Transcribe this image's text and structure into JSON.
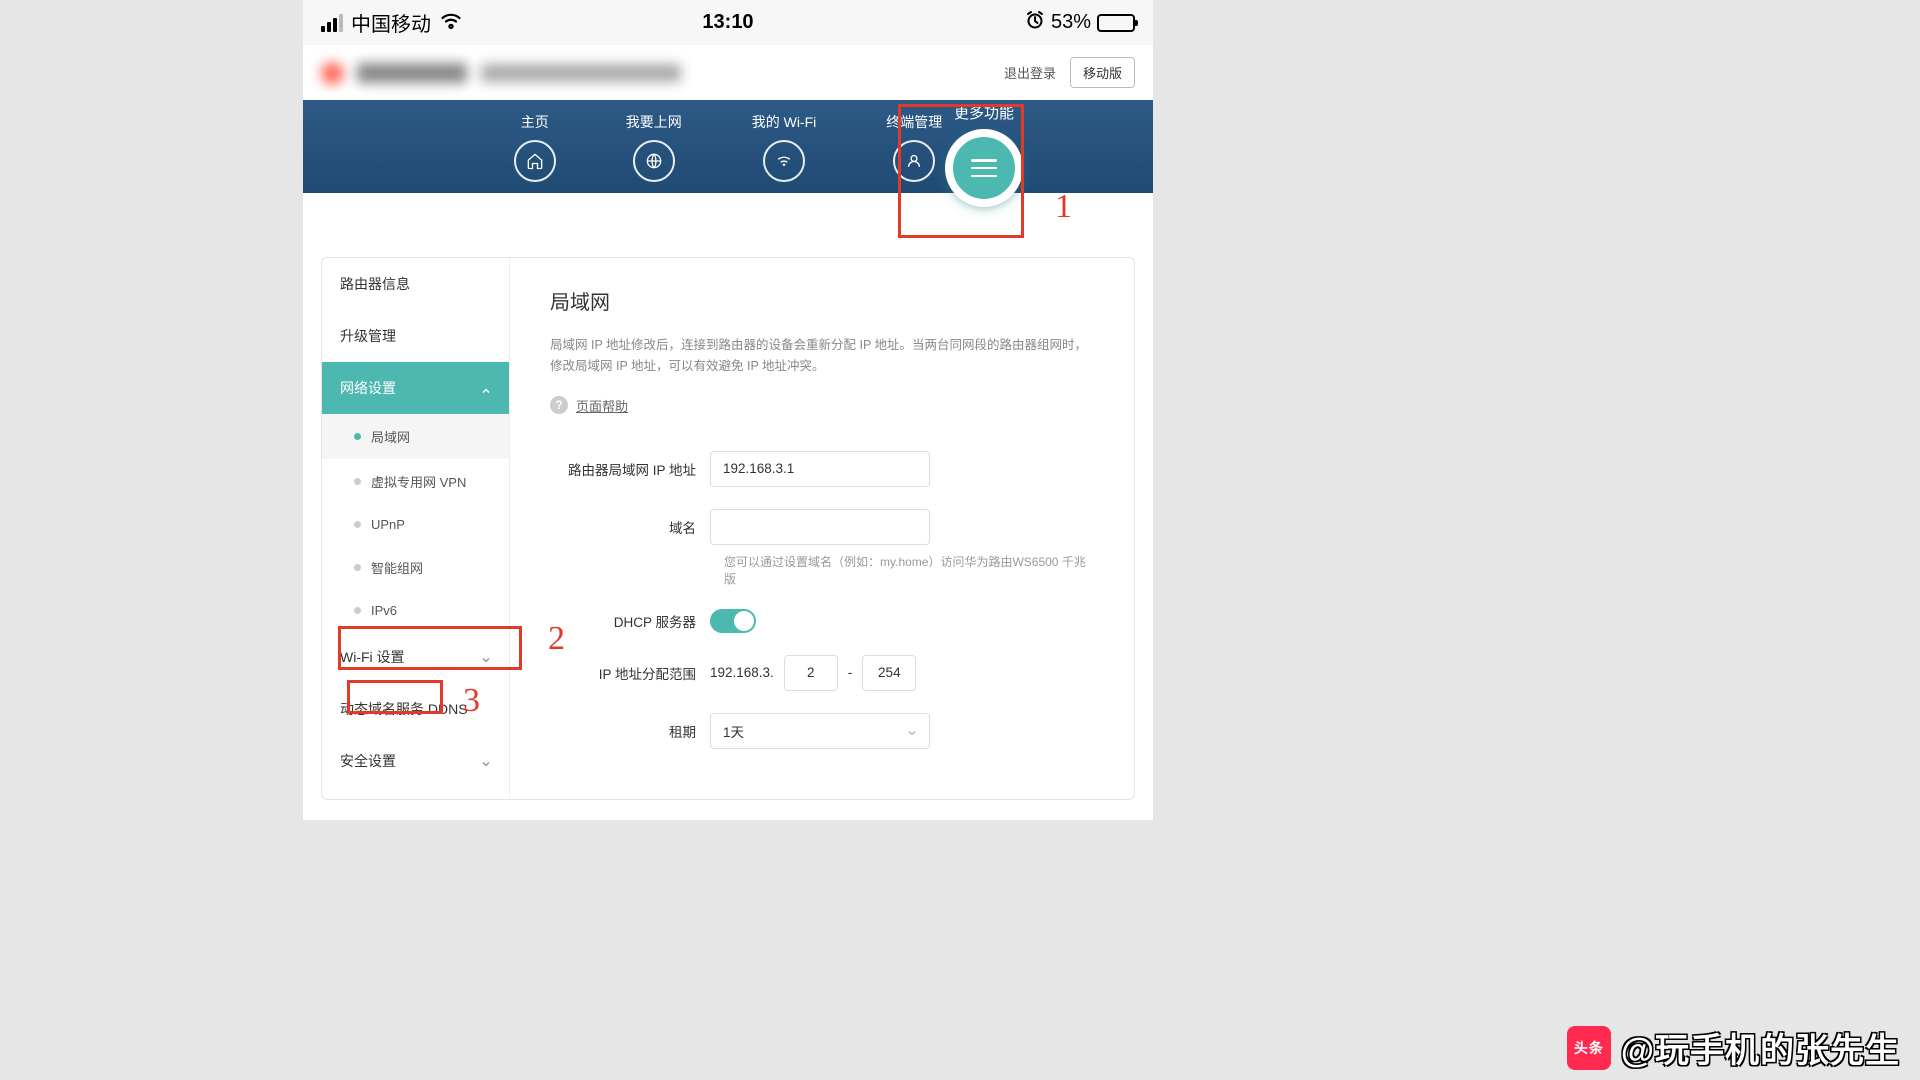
{
  "status_bar": {
    "carrier": "中国移动",
    "time": "13:10",
    "battery_pct": "53%"
  },
  "header": {
    "logout": "退出登录",
    "mobile_btn": "移动版"
  },
  "nav": {
    "home": "主页",
    "internet": "我要上网",
    "wifi": "我的 Wi-Fi",
    "devices": "终端管理",
    "more": "更多功能"
  },
  "annotations": {
    "n1": "1",
    "n2": "2",
    "n3": "3"
  },
  "sidebar": {
    "router_info": "路由器信息",
    "upgrade": "升级管理",
    "network": "网络设置",
    "subs": {
      "lan": "局域网",
      "vpn": "虚拟专用网 VPN",
      "upnp": "UPnP",
      "mesh": "智能组网",
      "ipv6": "IPv6"
    },
    "wifi_settings": "Wi-Fi 设置",
    "ddns": "动态域名服务 DDNS",
    "security": "安全设置"
  },
  "main": {
    "title": "局域网",
    "desc": "局域网 IP 地址修改后，连接到路由器的设备会重新分配 IP 地址。当两台同网段的路由器组网时，修改局域网 IP 地址，可以有效避免 IP 地址冲突。",
    "help": "页面帮助",
    "labels": {
      "lan_ip": "路由器局域网 IP 地址",
      "domain": "域名",
      "dhcp": "DHCP 服务器",
      "range": "IP 地址分配范围",
      "lease": "租期"
    },
    "values": {
      "lan_ip": "192.168.3.1",
      "domain": "",
      "range_prefix": "192.168.3.",
      "range_start": "2",
      "range_dash": "-",
      "range_end": "254",
      "lease": "1天"
    },
    "hint": "您可以通过设置域名（例如：my.home）访问华为路由WS6500 千兆版"
  },
  "watermark": {
    "brand": "头条",
    "text": "@玩手机的张先生"
  }
}
